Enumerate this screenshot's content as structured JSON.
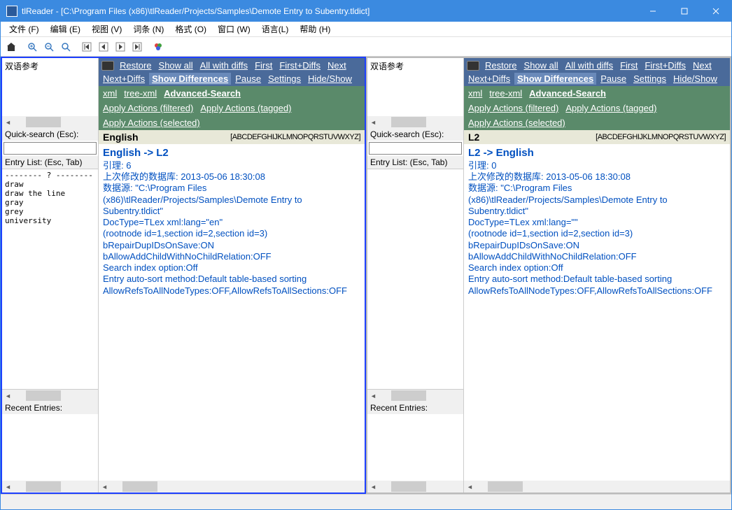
{
  "title": "tlReader - [C:\\Program Files (x86)\\tlReader/Projects/Samples\\Demote Entry to Subentry.tldict]",
  "menu": [
    "文件 (F)",
    "编辑 (E)",
    "视图 (V)",
    "词条 (N)",
    "格式 (O)",
    "窗口 (W)",
    "语言(L)",
    "帮助 (H)"
  ],
  "side": {
    "ref": "双语参考",
    "quick": "Quick-search (Esc):",
    "elist": "Entry List: (Esc, Tab)",
    "recent": "Recent Entries:",
    "entries_left": [
      "-------- ? --------",
      "draw",
      "draw the line",
      "gray",
      "grey",
      "university"
    ],
    "entries_right": []
  },
  "bar1": {
    "restore": "Restore",
    "showall": "Show all",
    "allwdiffs": "All with diffs",
    "first": "First",
    "firstdiffs": "First+Diffs",
    "next": "Next",
    "nextdiffs": "Next+Diffs",
    "showdiffs": "Show Differences",
    "pause": "Pause",
    "settings": "Settings",
    "hideshow": "Hide/Show"
  },
  "bar2": {
    "xml": "xml",
    "treexml": "tree-xml",
    "advsearch": "Advanced-Search",
    "apf": "Apply Actions (filtered)",
    "apt": "Apply Actions (tagged)",
    "aps": "Apply Actions (selected)"
  },
  "alpha": "[ABCDEFGHIJKLMNOPQRSTUVWXYZ]",
  "left": {
    "lang": "English",
    "heading": "English -> L2",
    "rows": [
      "引理: 6",
      "上次修改的数据库: 2013-05-06 18:30:08",
      "数据源: \"C:\\Program Files (x86)\\tlReader/Projects/Samples\\Demote Entry to Subentry.tldict\"",
      "DocType=TLex xml:lang=\"en\"",
      "(rootnode id=1,section id=2,section id=3)",
      "bRepairDupIDsOnSave:ON",
      "bAllowAddChildWithNoChildRelation:OFF",
      "Search index option:Off",
      "Entry auto-sort method:Default table-based sorting",
      "AllowRefsToAllNodeTypes:OFF,AllowRefsToAllSections:OFF"
    ]
  },
  "right": {
    "lang": "L2",
    "heading": "L2 -> English",
    "rows": [
      "引理: 0",
      "上次修改的数据库: 2013-05-06 18:30:08",
      "数据源: \"C:\\Program Files (x86)\\tlReader/Projects/Samples\\Demote Entry to Subentry.tldict\"",
      "DocType=TLex xml:lang=\"\"",
      "(rootnode id=1,section id=2,section id=3)",
      "bRepairDupIDsOnSave:ON",
      "bAllowAddChildWithNoChildRelation:OFF",
      "Search index option:Off",
      "Entry auto-sort method:Default table-based sorting",
      "AllowRefsToAllNodeTypes:OFF,AllowRefsToAllSections:OFF"
    ]
  }
}
